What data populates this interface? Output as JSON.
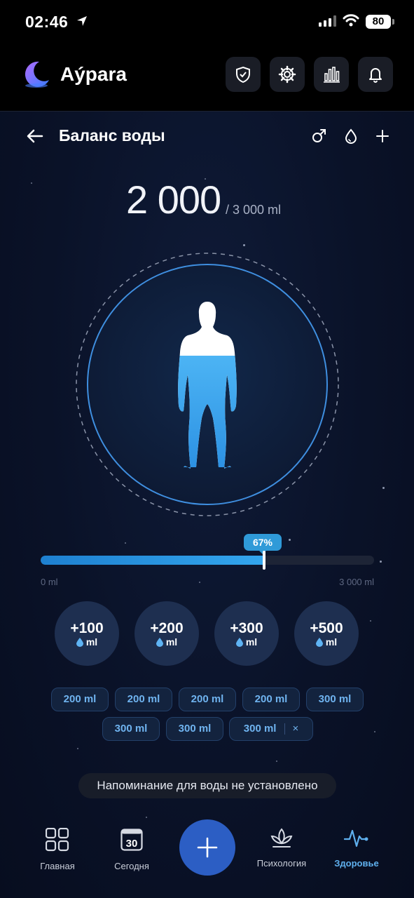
{
  "status_bar": {
    "time": "02:46",
    "battery": "80"
  },
  "app": {
    "name": "Аýрara"
  },
  "header_buttons": [
    "shield-icon",
    "gear-icon",
    "chart-icon",
    "bell-icon"
  ],
  "page": {
    "title": "Баланс воды"
  },
  "water": {
    "amount": "2 000",
    "goal": "/ 3 000 ml",
    "progress_label": "67%",
    "progress_fraction": 0.67,
    "min_label": "0 ml",
    "max_label": "3 000 ml"
  },
  "quick_add": [
    {
      "value": "+100",
      "unit": "ml"
    },
    {
      "value": "+200",
      "unit": "ml"
    },
    {
      "value": "+300",
      "unit": "ml"
    },
    {
      "value": "+500",
      "unit": "ml"
    }
  ],
  "presets": [
    "200 ml",
    "200 ml",
    "200 ml",
    "200 ml",
    "300 ml",
    "300 ml",
    "300 ml",
    "300 ml"
  ],
  "presets_clear": "×",
  "reminder": "Напоминание для воды не установлено",
  "nav": {
    "home": "Главная",
    "today": "Сегодня",
    "calendar_day": "30",
    "psychology": "Психология",
    "health": "Здоровье"
  },
  "colors": {
    "accent": "#2f9ad8",
    "fab": "#2c5ec4",
    "chip_text": "#6fb3ef"
  }
}
